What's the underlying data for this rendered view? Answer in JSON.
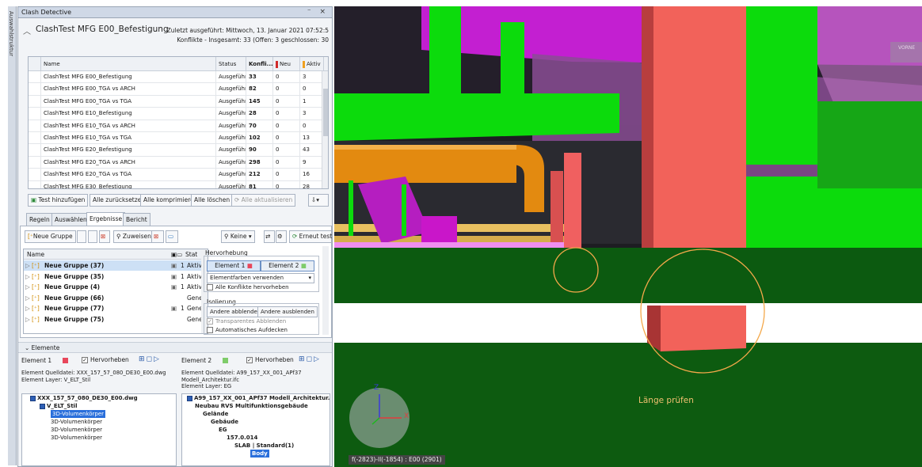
{
  "side_tab_label": "Auswahlstruktur",
  "panel": {
    "title": "Clash Detective",
    "controls": "⁻ ×",
    "test_title": "ClashTest MFG E00_Befestigung",
    "last_run": "Zuletzt ausgeführt: Mittwoch, 13. Januar 2021 07:52:5",
    "conflicts_summary": "Konflikte - Insgesamt: 33 (Offen: 3 geschlossen: 30"
  },
  "grid": {
    "headers": [
      "Name",
      "Status",
      "Konfli...",
      "Neu",
      "Aktiv"
    ],
    "rows": [
      [
        "ClashTest MFG E00_Befestigung",
        "Ausgeführ",
        "33",
        "0",
        "3"
      ],
      [
        "ClashTest MFG E00_TGA vs ARCH",
        "Ausgeführ",
        "82",
        "0",
        "0"
      ],
      [
        "ClashTest MFG E00_TGA vs TGA",
        "Ausgeführ",
        "145",
        "0",
        "1"
      ],
      [
        "ClashTest MFG E10_Befestigung",
        "Ausgeführ",
        "28",
        "0",
        "3"
      ],
      [
        "ClashTest MFG E10_TGA vs ARCH",
        "Ausgeführ",
        "70",
        "0",
        "0"
      ],
      [
        "ClashTest MFG E10_TGA vs TGA",
        "Ausgeführ",
        "102",
        "0",
        "13"
      ],
      [
        "ClashTest MFG E20_Befestigung",
        "Ausgeführ",
        "90",
        "0",
        "43"
      ],
      [
        "ClashTest MFG E20_TGA vs ARCH",
        "Ausgeführ",
        "298",
        "0",
        "9"
      ],
      [
        "ClashTest MFG E20_TGA vs TGA",
        "Ausgeführ",
        "212",
        "0",
        "16"
      ],
      [
        "ClashTest MFG E30_Befestigung",
        "Ausgeführ",
        "81",
        "0",
        "28"
      ]
    ]
  },
  "actions": {
    "add_test": "Test hinzufügen",
    "reset_all": "Alle zurücksetzen",
    "compress_all": "Alle komprimieren",
    "delete_all": "Alle löschen",
    "update_all": "Alle aktualisieren"
  },
  "tabs": [
    "Regeln",
    "Auswählen",
    "Ergebnisse",
    "Bericht"
  ],
  "results_toolbar": {
    "new_group": "Neue Gruppe",
    "assign": "Zuweisen",
    "none_dropdown": "Keine",
    "retest": "Erneut testen"
  },
  "results_tree": {
    "col_name": "Name",
    "col_status": "Stat",
    "rows": [
      {
        "name": "Neue Gruppe (37)",
        "count": "1",
        "status": "Aktiv",
        "cam": true
      },
      {
        "name": "Neue Gruppe (35)",
        "count": "1",
        "status": "Aktiv",
        "cam": true
      },
      {
        "name": "Neue Gruppe (4)",
        "count": "1",
        "status": "Aktiv",
        "cam": true
      },
      {
        "name": "Neue Gruppe (66)",
        "count": "",
        "status": "Gene",
        "cam": false
      },
      {
        "name": "Neue Gruppe (77)",
        "count": "1",
        "status": "Gene",
        "cam": true
      },
      {
        "name": "Neue Gruppe (75)",
        "count": "",
        "status": "Gene",
        "cam": false
      }
    ]
  },
  "highlight": {
    "group_title": "Hervorhebung",
    "element1": "Element 1",
    "element2": "Element 2",
    "element_colors": "Elementfarben verwenden",
    "highlight_all": "Alle Konflikte hervorheben"
  },
  "isolation": {
    "group_title": "Isolierung",
    "dim_others": "Andere abblenden",
    "hide_others": "Andere ausblenden",
    "transparent_dim": "Transparentes Abblenden",
    "auto_reveal": "Automatisches Aufdecken"
  },
  "elements": {
    "header": "Elemente",
    "left": {
      "label": "Element 1",
      "color": "#e8475b",
      "highlight": "Hervorheben",
      "source": "Element Quelldatei: XXX_157_57_080_DE30_E00.dwg",
      "layer": "Element Layer: V_ELT_Stil",
      "tree": [
        "XXX_157_57_080_DE30_E00.dwg",
        "V_ELT_Stil",
        "3D-Volumenkörper",
        "3D-Volumenkörper",
        "3D-Volumenkörper",
        "3D-Volumenkörper"
      ]
    },
    "right": {
      "label": "Element 2",
      "color": "#7fcc6a",
      "highlight": "Hervorheben",
      "source": "Element Quelldatei: A99_157_XX_001_APf37",
      "source2": "Modell_Architektur.ifc",
      "layer": "Element Layer: EG",
      "tree": [
        "A99_157_XX_001_APf37 Modell_Architektur.ifc",
        "Neubau RVS Multifunktionsgebäude",
        "Gelände",
        "Gebäude",
        "EG",
        "157.0.014",
        "SLAB | Standard(1)",
        "Body"
      ]
    }
  },
  "viewport": {
    "label": "Länge prüfen",
    "status": "f(-2823)-ll(-1854) : E00 (2901)",
    "axis_z": "Z",
    "axis_x": "X",
    "view_btn": "VORNE"
  }
}
